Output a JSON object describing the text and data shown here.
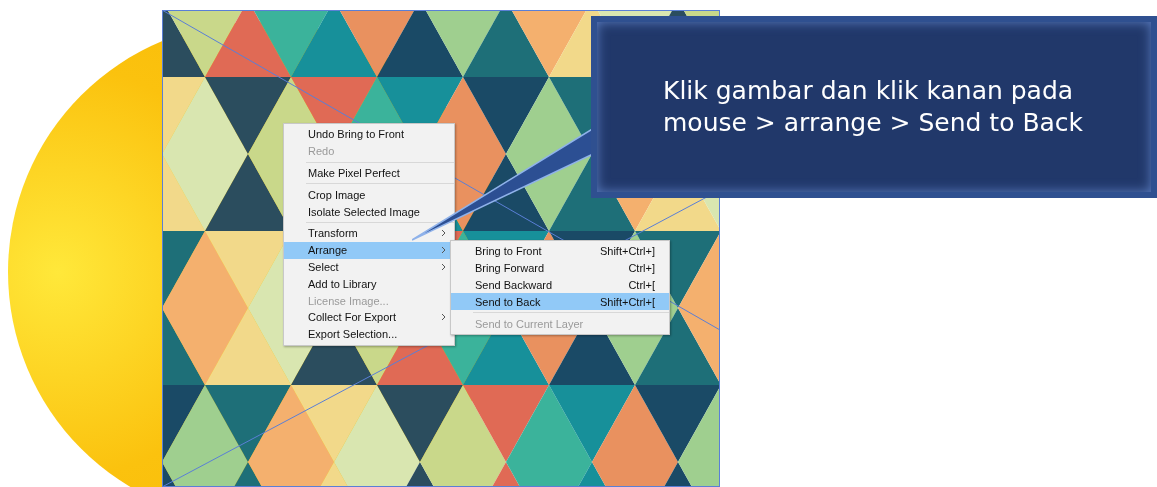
{
  "context_menu": {
    "groups": [
      [
        {
          "label": "Undo Bring to Front",
          "disabled": false,
          "selected": false,
          "has_submenu": false
        },
        {
          "label": "Redo",
          "disabled": true,
          "selected": false,
          "has_submenu": false
        }
      ],
      [
        {
          "label": "Make Pixel Perfect",
          "disabled": false,
          "selected": false,
          "has_submenu": false
        }
      ],
      [
        {
          "label": "Crop Image",
          "disabled": false,
          "selected": false,
          "has_submenu": false
        },
        {
          "label": "Isolate Selected Image",
          "disabled": false,
          "selected": false,
          "has_submenu": false
        }
      ],
      [
        {
          "label": "Transform",
          "disabled": false,
          "selected": false,
          "has_submenu": true
        },
        {
          "label": "Arrange",
          "disabled": false,
          "selected": true,
          "has_submenu": true
        },
        {
          "label": "Select",
          "disabled": false,
          "selected": false,
          "has_submenu": true
        },
        {
          "label": "Add to Library",
          "disabled": false,
          "selected": false,
          "has_submenu": false
        },
        {
          "label": "License Image...",
          "disabled": true,
          "selected": false,
          "has_submenu": false
        },
        {
          "label": "Collect For Export",
          "disabled": false,
          "selected": false,
          "has_submenu": true
        },
        {
          "label": "Export Selection...",
          "disabled": false,
          "selected": false,
          "has_submenu": false
        }
      ]
    ]
  },
  "submenu": {
    "groups": [
      [
        {
          "label": "Bring to Front",
          "shortcut": "Shift+Ctrl+]",
          "disabled": false,
          "selected": false
        },
        {
          "label": "Bring Forward",
          "shortcut": "Ctrl+]",
          "disabled": false,
          "selected": false
        },
        {
          "label": "Send Backward",
          "shortcut": "Ctrl+[",
          "disabled": false,
          "selected": false
        },
        {
          "label": "Send to Back",
          "shortcut": "Shift+Ctrl+[",
          "disabled": false,
          "selected": true
        }
      ],
      [
        {
          "label": "Send to Current Layer",
          "disabled": true,
          "selected": false
        }
      ]
    ]
  },
  "callout": {
    "text": "Klik gambar dan klik kanan pada mouse > arrange > Send to Back"
  }
}
